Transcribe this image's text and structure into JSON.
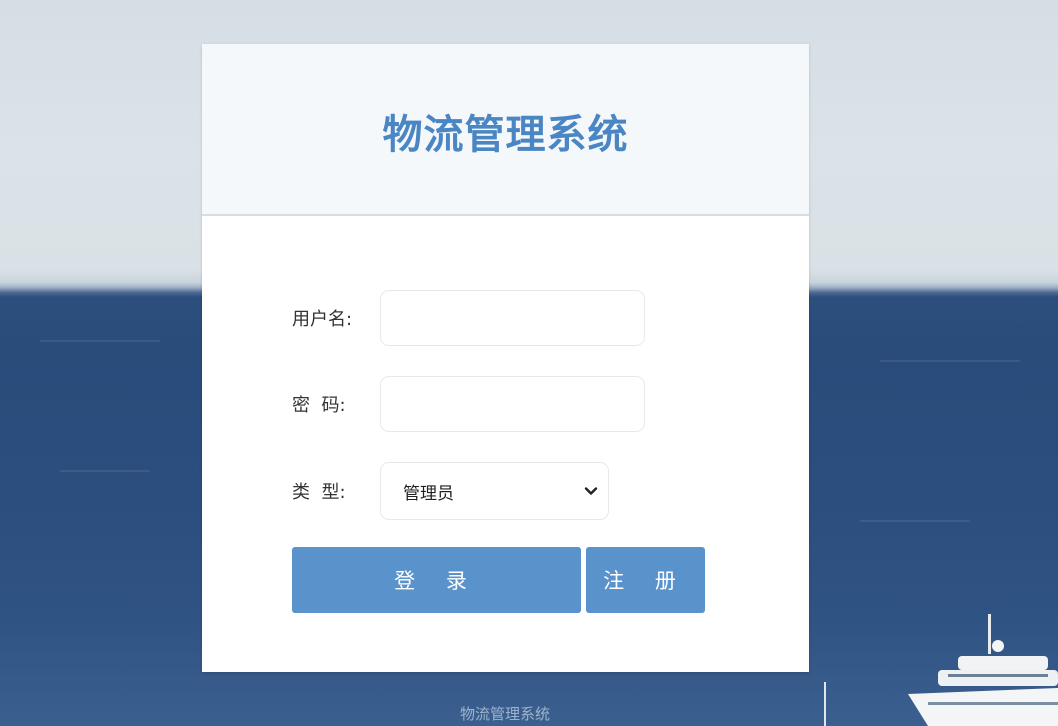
{
  "app": {
    "title": "物流管理系统"
  },
  "form": {
    "username_label": "用户名:",
    "username_value": "",
    "password_label": "密  码:",
    "password_value": "",
    "type_label": "类  型:",
    "type_selected": "管理员"
  },
  "buttons": {
    "login_label": "登 录",
    "register_label": "注 册"
  },
  "footer": {
    "text": "物流管理系统"
  },
  "colors": {
    "accent": "#5a92cc",
    "title": "#4a86c4"
  },
  "icons": {
    "select_chevron": "chevron-down-icon"
  }
}
